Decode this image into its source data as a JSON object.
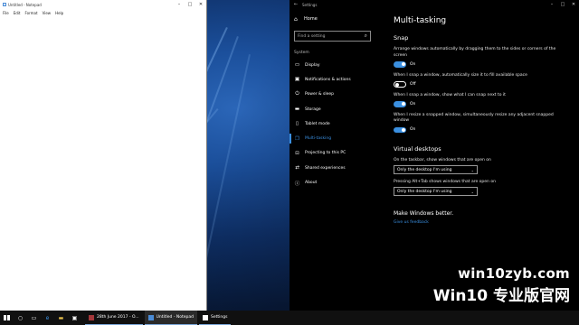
{
  "notepad": {
    "title": "Untitled - Notepad",
    "menu": [
      "File",
      "Edit",
      "Format",
      "View",
      "Help"
    ],
    "controls": [
      "–",
      "□",
      "✕"
    ]
  },
  "settings": {
    "window_title": "Settings",
    "controls": [
      "–",
      "□",
      "✕"
    ],
    "back_label": "←",
    "nav": {
      "home": "Home",
      "search_placeholder": "Find a setting",
      "section": "System",
      "items": [
        {
          "label": "Display",
          "icon": "display-icon",
          "glyph": "▭"
        },
        {
          "label": "Notifications & actions",
          "icon": "notifications-icon",
          "glyph": "▣"
        },
        {
          "label": "Power & sleep",
          "icon": "power-icon",
          "glyph": "⏻"
        },
        {
          "label": "Storage",
          "icon": "storage-icon",
          "glyph": "▬"
        },
        {
          "label": "Tablet mode",
          "icon": "tablet-icon",
          "glyph": "▯"
        },
        {
          "label": "Multi-tasking",
          "icon": "multitasking-icon",
          "glyph": "❐",
          "active": true
        },
        {
          "label": "Projecting to this PC",
          "icon": "projecting-icon",
          "glyph": "⊡"
        },
        {
          "label": "Shared experiences",
          "icon": "shared-icon",
          "glyph": "⇄"
        },
        {
          "label": "About",
          "icon": "about-icon",
          "glyph": "ⓘ"
        }
      ]
    },
    "content": {
      "title": "Multi-tasking",
      "snap_head": "Snap",
      "snap_items": [
        {
          "desc": "Arrange windows automatically by dragging them to the sides or corners of the screen",
          "state": "On",
          "on": true
        },
        {
          "desc": "When I snap a window, automatically size it to fill available space",
          "state": "Off",
          "on": false
        },
        {
          "desc": "When I snap a window, show what I can snap next to it",
          "state": "On",
          "on": true
        },
        {
          "desc": "When I resize a snapped window, simultaneously resize any adjacent snapped window",
          "state": "On",
          "on": true
        }
      ],
      "vd_head": "Virtual desktops",
      "taskbar_label": "On the taskbar, show windows that are open on",
      "taskbar_value": "Only the desktop I'm using",
      "alttab_label": "Pressing Alt+Tab shows windows that are open on",
      "alttab_value": "Only the desktop I'm using",
      "mwb_head": "Make Windows better.",
      "feedback": "Give us feedback"
    }
  },
  "taskbar": {
    "tasks": [
      {
        "label": "28th June 2017 - O...",
        "icon": "onenote-icon",
        "color": "#a4373a"
      },
      {
        "label": "Untitled - Notepad",
        "icon": "notepad-icon",
        "color": "#4a8bd6"
      },
      {
        "label": "Settings",
        "icon": "settings-icon",
        "color": "#ffffff"
      }
    ]
  },
  "watermark": {
    "line1": "win10zyb.com",
    "line2": "Win10 专业版官网"
  }
}
